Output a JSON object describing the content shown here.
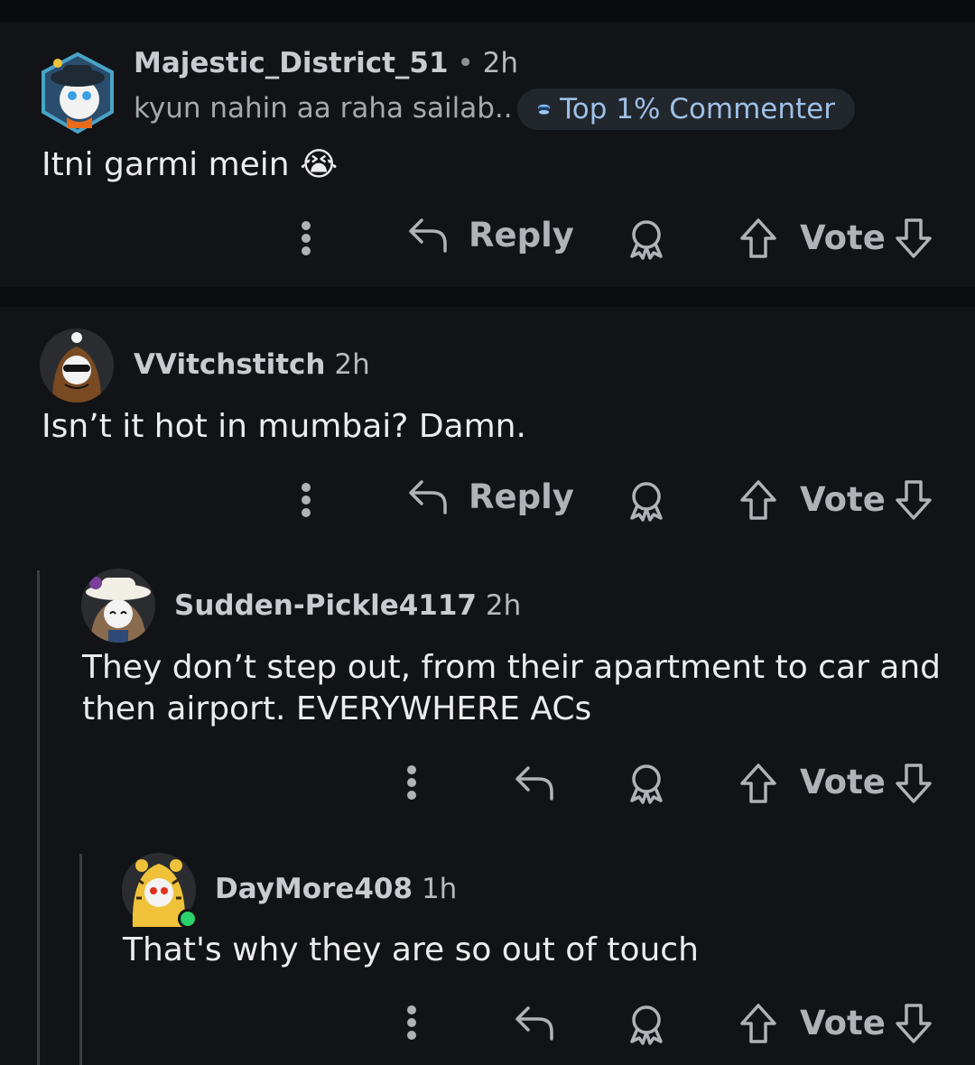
{
  "comments": [
    {
      "username": "Majestic_District_51",
      "separator": "•",
      "time": "2h",
      "flair": "kyun nahin aa raha sailab..",
      "badge": "Top 1% Commenter",
      "text": "Itni garmi mein 😭",
      "reply_label": "Reply",
      "vote_label": "Vote"
    },
    {
      "username": "VVitchstitch",
      "time": "2h",
      "text": "Isn’t it hot in mumbai? Damn.",
      "reply_label": "Reply",
      "vote_label": "Vote"
    },
    {
      "username": "Sudden-Pickle4117",
      "time": "2h",
      "text": "They don’t step out, from their apartment to car and then airport. EVERYWHERE ACs",
      "vote_label": "Vote"
    },
    {
      "username": "DayMore408",
      "time": "1h",
      "text": "That's why they are so out of touch",
      "vote_label": "Vote"
    }
  ],
  "colors": {
    "background": "#121316",
    "online": "#2bd16b",
    "badge_text": "#9fc0e6"
  },
  "icons": [
    "more-vertical-icon",
    "reply-arrow-icon",
    "award-icon",
    "upvote-arrow-icon",
    "downvote-arrow-icon",
    "online-dot-icon"
  ]
}
